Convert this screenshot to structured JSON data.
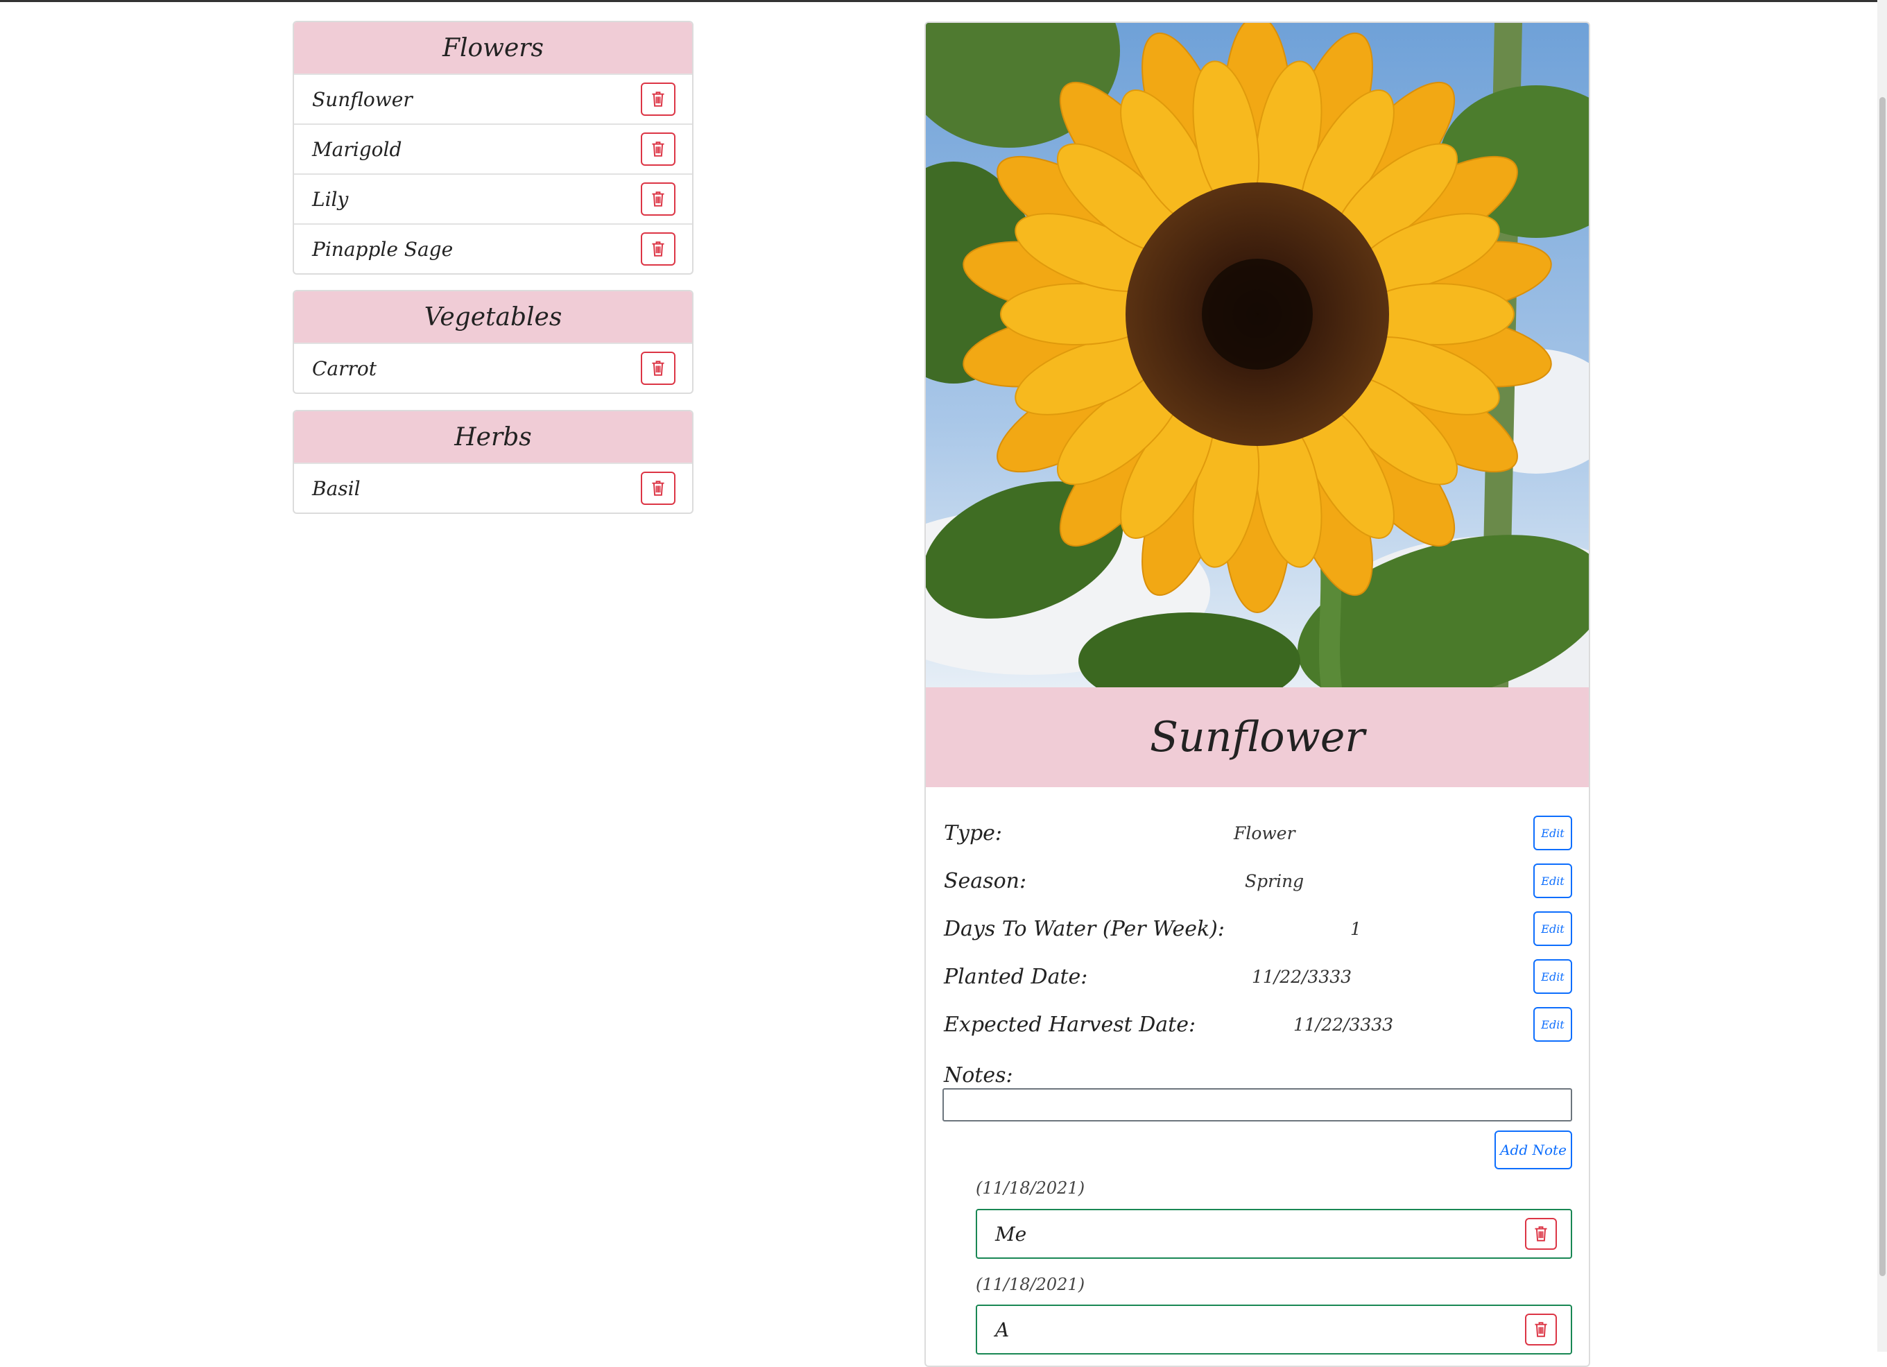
{
  "categories": [
    {
      "title": "Flowers",
      "items": [
        "Sunflower",
        "Marigold",
        "Lily",
        "Pinapple Sage"
      ]
    },
    {
      "title": "Vegetables",
      "items": [
        "Carrot"
      ]
    },
    {
      "title": "Herbs",
      "items": [
        "Basil"
      ]
    }
  ],
  "detail": {
    "title": "Sunflower",
    "fields": [
      {
        "label": "Type:",
        "value": "Flower",
        "edit": "Edit"
      },
      {
        "label": "Season:",
        "value": "Spring",
        "edit": "Edit"
      },
      {
        "label": "Days To Water (Per Week):",
        "value": "1",
        "edit": "Edit"
      },
      {
        "label": "Planted Date:",
        "value": "11/22/3333",
        "edit": "Edit"
      },
      {
        "label": "Expected Harvest Date:",
        "value": "11/22/3333",
        "edit": "Edit"
      }
    ],
    "notes_label": "Notes:",
    "notes_input_value": "",
    "add_note_label": "Add Note",
    "notes": [
      {
        "date": "(11/18/2021)",
        "text": "Me"
      },
      {
        "date": "(11/18/2021)",
        "text": "A"
      }
    ]
  },
  "icons": {
    "delete": "trash-icon"
  },
  "colors": {
    "header_pink": "#f0ccd6",
    "danger": "#dc3545",
    "primary": "#0d6efd",
    "success": "#198754"
  }
}
